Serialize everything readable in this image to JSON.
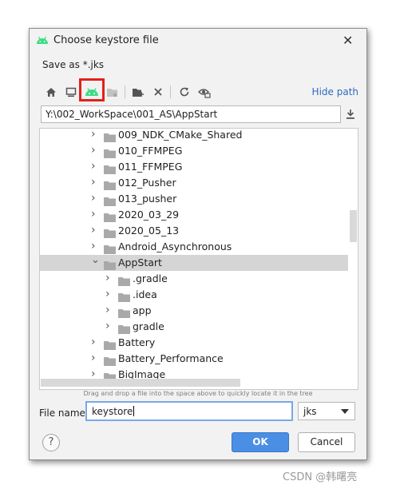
{
  "dialog": {
    "title": "Choose keystore file",
    "subtitle": "Save as *.jks",
    "hide_path_label": "Hide path",
    "path_value": "Y:\\002_WorkSpace\\001_AS\\AppStart",
    "hint": "Drag and drop a file into the space above to quickly locate it in the tree",
    "file_name_label": "File name:",
    "file_name_value": "keystore",
    "extension_selected": "jks",
    "help_label": "?",
    "ok_label": "OK",
    "cancel_label": "Cancel"
  },
  "tree": {
    "items": [
      {
        "label": "009_NDK_CMake_Shared",
        "level": 0,
        "expanded": false
      },
      {
        "label": "010_FFMPEG",
        "level": 0,
        "expanded": false
      },
      {
        "label": "011_FFMPEG",
        "level": 0,
        "expanded": false
      },
      {
        "label": "012_Pusher",
        "level": 0,
        "expanded": false
      },
      {
        "label": "013_pusher",
        "level": 0,
        "expanded": false
      },
      {
        "label": "2020_03_29",
        "level": 0,
        "expanded": false
      },
      {
        "label": "2020_05_13",
        "level": 0,
        "expanded": false
      },
      {
        "label": "Android_Asynchronous",
        "level": 0,
        "expanded": false
      },
      {
        "label": "AppStart",
        "level": 0,
        "expanded": true,
        "selected": true
      },
      {
        "label": ".gradle",
        "level": 1,
        "expanded": false
      },
      {
        "label": ".idea",
        "level": 1,
        "expanded": false
      },
      {
        "label": "app",
        "level": 1,
        "expanded": false
      },
      {
        "label": "gradle",
        "level": 1,
        "expanded": false
      },
      {
        "label": "Battery",
        "level": 0,
        "expanded": false
      },
      {
        "label": "Battery_Performance",
        "level": 0,
        "expanded": false
      },
      {
        "label": "BigImage",
        "level": 0,
        "expanded": false
      }
    ]
  },
  "toolbar_icons": [
    "home-icon",
    "desktop-icon",
    "android-project-icon",
    "module-folder-icon",
    "new-folder-icon",
    "delete-icon",
    "refresh-icon",
    "show-hidden-icon"
  ],
  "colors": {
    "accent": "#4a8fe3",
    "link": "#2d6bbf",
    "highlight_box": "#e32119",
    "android_green": "#3ddc84"
  },
  "watermark": "CSDN @韩曙亮"
}
